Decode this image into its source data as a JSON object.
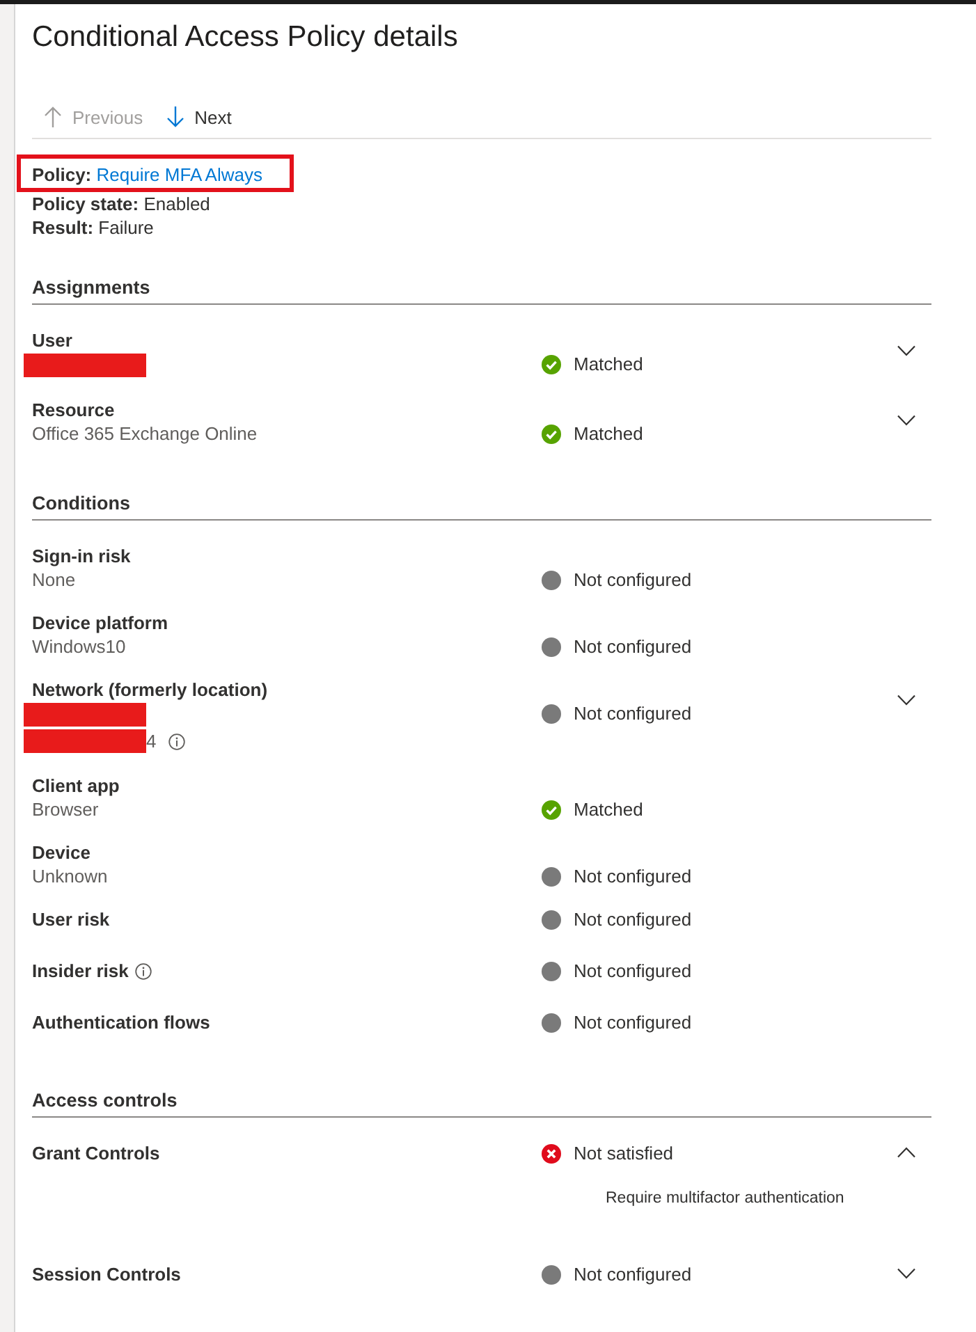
{
  "window": {
    "title": "Conditional Access Policy details"
  },
  "toolbar": [
    {
      "kind": "previous",
      "label": "Previous",
      "disabled": true
    },
    {
      "kind": "next",
      "label": "Next",
      "disabled": false
    }
  ],
  "summary": {
    "policy": {
      "label": "Policy:",
      "link": "Require MFA Always",
      "highlighted": true
    },
    "fields": [
      {
        "label": "Policy state:",
        "value": "Enabled"
      },
      {
        "label": "Result:",
        "value": "Failure"
      }
    ]
  },
  "sections": [
    {
      "title": "Assignments",
      "rows": [
        {
          "label": "User",
          "info": false,
          "values": [
            {
              "redacted": true,
              "info": false
            }
          ],
          "status": {
            "kind": "matched",
            "text": "Matched"
          },
          "expandable": true,
          "expanded": false
        },
        {
          "label": "Resource",
          "info": false,
          "values": [
            {
              "text": "Office 365 Exchange Online",
              "redacted": false,
              "info": false
            }
          ],
          "status": {
            "kind": "matched",
            "text": "Matched"
          },
          "expandable": true,
          "expanded": false
        }
      ]
    },
    {
      "title": "Conditions",
      "rows": [
        {
          "label": "Sign-in risk",
          "info": false,
          "values": [
            {
              "text": "None",
              "redacted": false,
              "info": false
            }
          ],
          "status": {
            "kind": "not_configured",
            "text": "Not configured"
          },
          "expandable": false
        },
        {
          "label": "Device platform",
          "info": false,
          "values": [
            {
              "text": "Windows10",
              "redacted": false,
              "info": false
            }
          ],
          "status": {
            "kind": "not_configured",
            "text": "Not configured"
          },
          "expandable": false
        },
        {
          "label": "Network (formerly location)",
          "info": false,
          "values": [
            {
              "redacted": true,
              "info": false
            },
            {
              "text": "4",
              "redacted": true,
              "info": true
            }
          ],
          "status": {
            "kind": "not_configured",
            "text": "Not configured"
          },
          "expandable": true,
          "expanded": false
        },
        {
          "label": "Client app",
          "info": false,
          "values": [
            {
              "text": "Browser",
              "redacted": false,
              "info": false
            }
          ],
          "status": {
            "kind": "matched",
            "text": "Matched"
          },
          "expandable": false
        },
        {
          "label": "Device",
          "info": false,
          "values": [
            {
              "text": "Unknown",
              "redacted": false,
              "info": false
            }
          ],
          "status": {
            "kind": "not_configured",
            "text": "Not configured"
          },
          "expandable": false
        },
        {
          "label": "User risk",
          "info": false,
          "status": {
            "kind": "not_configured",
            "text": "Not configured"
          },
          "expandable": false
        },
        {
          "label": "Insider risk",
          "info": true,
          "status": {
            "kind": "not_configured",
            "text": "Not configured"
          },
          "expandable": false
        },
        {
          "label": "Authentication flows",
          "info": false,
          "status": {
            "kind": "not_configured",
            "text": "Not configured"
          },
          "expandable": false
        }
      ]
    },
    {
      "title": "Access controls",
      "rows": [
        {
          "label": "Grant Controls",
          "info": false,
          "status": {
            "kind": "not_satisfied",
            "text": "Not satisfied"
          },
          "expandable": true,
          "expanded": true,
          "details": [
            "Require multifactor authentication"
          ]
        },
        {
          "label": "Session Controls",
          "info": false,
          "status": {
            "kind": "not_configured",
            "text": "Not configured"
          },
          "expandable": true,
          "expanded": false
        }
      ]
    }
  ]
}
